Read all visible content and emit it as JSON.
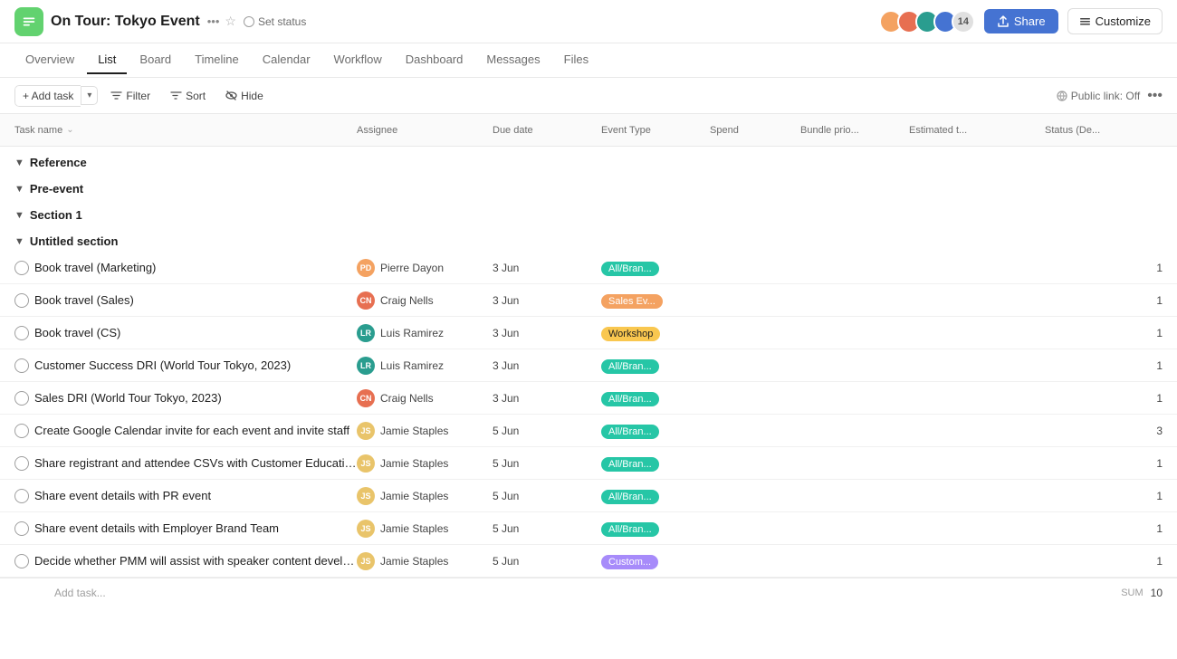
{
  "app": {
    "icon_color": "#62d26f",
    "project_title": "On Tour: Tokyo Event",
    "set_status": "Set status"
  },
  "nav": {
    "tabs": [
      {
        "label": "Overview",
        "active": false
      },
      {
        "label": "List",
        "active": true
      },
      {
        "label": "Board",
        "active": false
      },
      {
        "label": "Timeline",
        "active": false
      },
      {
        "label": "Calendar",
        "active": false
      },
      {
        "label": "Workflow",
        "active": false
      },
      {
        "label": "Dashboard",
        "active": false
      },
      {
        "label": "Messages",
        "active": false
      },
      {
        "label": "Files",
        "active": false
      }
    ]
  },
  "toolbar": {
    "add_task": "+ Add task",
    "filter": "Filter",
    "sort": "Sort",
    "hide": "Hide",
    "public_link": "Public link: Off"
  },
  "columns": {
    "task_name": "Task name",
    "assignee": "Assignee",
    "due_date": "Due date",
    "event_type": "Event Type",
    "spend": "Spend",
    "bundle_prio": "Bundle prio...",
    "estimated_t": "Estimated t...",
    "status": "Status (De..."
  },
  "sections": [
    {
      "name": "Reference",
      "expanded": true,
      "tasks": []
    },
    {
      "name": "Pre-event",
      "expanded": true,
      "tasks": []
    },
    {
      "name": "Section 1",
      "expanded": true,
      "tasks": []
    },
    {
      "name": "Untitled section",
      "expanded": true,
      "tasks": [
        {
          "name": "Book travel (Marketing)",
          "assignee": "Pierre Dayon",
          "assignee_initials": "PD",
          "assignee_class": "av-pierre",
          "due_date": "3 Jun",
          "event_type": "All/Bran...",
          "event_type_color": "#26c6a6",
          "event_type_text_color": "#fff",
          "spend": "",
          "bundle": "",
          "estimated": "",
          "status": "1"
        },
        {
          "name": "Book travel (Sales)",
          "assignee": "Craig Nells",
          "assignee_initials": "CN",
          "assignee_class": "av-craig",
          "due_date": "3 Jun",
          "event_type": "Sales Ev...",
          "event_type_color": "#f4a261",
          "event_type_text_color": "#fff",
          "spend": "",
          "bundle": "",
          "estimated": "",
          "status": "1"
        },
        {
          "name": "Book travel (CS)",
          "assignee": "Luis Ramirez",
          "assignee_initials": "LR",
          "assignee_class": "av-luis",
          "due_date": "3 Jun",
          "event_type": "Workshop",
          "event_type_color": "#f9c74f",
          "event_type_text_color": "#1e1e1e",
          "spend": "",
          "bundle": "",
          "estimated": "",
          "status": "1"
        },
        {
          "name": "Customer Success DRI (World Tour Tokyo, 2023)",
          "assignee": "Luis Ramirez",
          "assignee_initials": "LR",
          "assignee_class": "av-luis",
          "due_date": "3 Jun",
          "event_type": "All/Bran...",
          "event_type_color": "#26c6a6",
          "event_type_text_color": "#fff",
          "spend": "",
          "bundle": "",
          "estimated": "",
          "status": "1"
        },
        {
          "name": "Sales DRI (World Tour Tokyo, 2023)",
          "assignee": "Craig Nells",
          "assignee_initials": "CN",
          "assignee_class": "av-craig",
          "due_date": "3 Jun",
          "event_type": "All/Bran...",
          "event_type_color": "#26c6a6",
          "event_type_text_color": "#fff",
          "spend": "",
          "bundle": "",
          "estimated": "",
          "status": "1"
        },
        {
          "name": "Create Google Calendar invite for each event and invite staff",
          "assignee": "Jamie Staples",
          "assignee_initials": "JS",
          "assignee_class": "av-jamie",
          "due_date": "5 Jun",
          "event_type": "All/Bran...",
          "event_type_color": "#26c6a6",
          "event_type_text_color": "#fff",
          "spend": "",
          "bundle": "",
          "estimated": "",
          "status": "3"
        },
        {
          "name": "Share registrant and attendee CSVs with Customer Education Team",
          "assignee": "Jamie Staples",
          "assignee_initials": "JS",
          "assignee_class": "av-jamie",
          "due_date": "5 Jun",
          "event_type": "All/Bran...",
          "event_type_color": "#26c6a6",
          "event_type_text_color": "#fff",
          "spend": "",
          "bundle": "",
          "estimated": "",
          "status": "1"
        },
        {
          "name": "Share event details with PR event",
          "assignee": "Jamie Staples",
          "assignee_initials": "JS",
          "assignee_class": "av-jamie",
          "due_date": "5 Jun",
          "event_type": "All/Bran...",
          "event_type_color": "#26c6a6",
          "event_type_text_color": "#fff",
          "spend": "",
          "bundle": "",
          "estimated": "",
          "status": "1"
        },
        {
          "name": "Share event details with Employer Brand Team",
          "assignee": "Jamie Staples",
          "assignee_initials": "JS",
          "assignee_class": "av-jamie",
          "due_date": "5 Jun",
          "event_type": "All/Bran...",
          "event_type_color": "#26c6a6",
          "event_type_text_color": "#fff",
          "spend": "",
          "bundle": "",
          "estimated": "",
          "status": "1"
        },
        {
          "name": "Decide whether PMM will assist with speaker content development",
          "assignee": "Jamie Staples",
          "assignee_initials": "JS",
          "assignee_class": "av-jamie",
          "due_date": "5 Jun",
          "event_type": "Custom...",
          "event_type_color": "#a78bfa",
          "event_type_text_color": "#fff",
          "spend": "",
          "bundle": "",
          "estimated": "",
          "status": "1"
        }
      ],
      "add_task_label": "Add task...",
      "sum_label": "SUM",
      "sum_value": "10"
    }
  ],
  "avatars": {
    "count_label": "14",
    "colors": [
      "#f4a261",
      "#e76f51",
      "#2a9d8f",
      "#e9c46a"
    ]
  },
  "share_label": "Share",
  "customize_label": "Customize"
}
